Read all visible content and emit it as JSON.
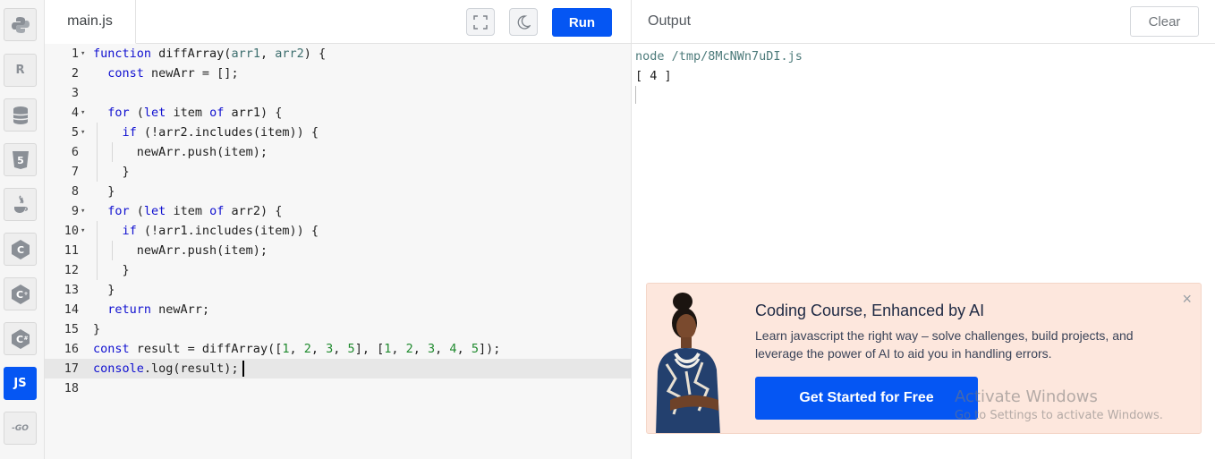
{
  "sidebar": {
    "languages": [
      {
        "name": "python-icon"
      },
      {
        "name": "r-icon",
        "text": "R"
      },
      {
        "name": "database-icon"
      },
      {
        "name": "html5-icon",
        "text": "5"
      },
      {
        "name": "java-icon"
      },
      {
        "name": "c-icon",
        "text": "C"
      },
      {
        "name": "cpp-icon",
        "text": "C"
      },
      {
        "name": "csharp-icon",
        "text": "C"
      },
      {
        "name": "javascript-button",
        "text": "JS"
      },
      {
        "name": "go-icon",
        "text": "-GO"
      }
    ]
  },
  "editor": {
    "file_tab": "main.js",
    "run_label": "Run",
    "current_line": 17,
    "lines": [
      "1",
      "2",
      "3",
      "4",
      "5",
      "6",
      "7",
      "8",
      "9",
      "10",
      "11",
      "12",
      "13",
      "14",
      "15",
      "16",
      "17",
      "18"
    ]
  },
  "output": {
    "title": "Output",
    "clear_label": "Clear",
    "command": "node /tmp/8McNWn7uDI.js",
    "result": "[ 4 ]"
  },
  "promo": {
    "title": "Coding Course, Enhanced by AI",
    "description": "Learn javascript the right way – solve challenges, build projects, and leverage the power of AI to aid you in handling errors.",
    "cta": "Get Started for Free",
    "close": "×"
  },
  "watermark": {
    "title": "Activate Windows",
    "subtitle": "Go to Settings to activate Windows."
  },
  "colors": {
    "accent": "#0556f3",
    "promo_bg": "#fde7dd"
  }
}
